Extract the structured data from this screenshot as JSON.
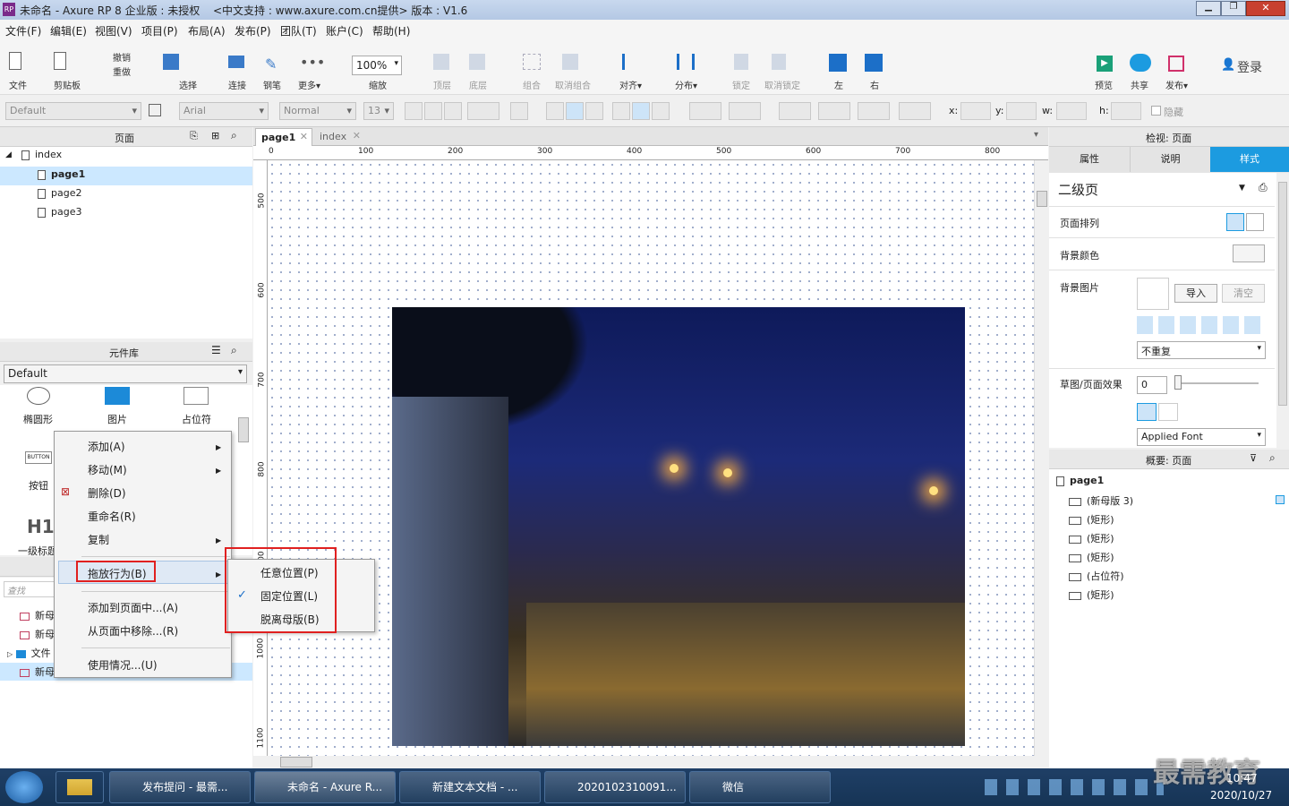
{
  "window": {
    "title": "未命名 - Axure RP 8 企业版 : 未授权",
    "subtitle": "<中文支持 : www.axure.com.cn提供> 版本 : V1.6"
  },
  "menu": [
    "文件(F)",
    "编辑(E)",
    "视图(V)",
    "项目(P)",
    "布局(A)",
    "发布(P)",
    "团队(T)",
    "账户(C)",
    "帮助(H)"
  ],
  "toolbar": {
    "file": "文件",
    "clipboard": "剪贴板",
    "undo": "撤销",
    "redo": "重做",
    "select": "选择",
    "connect": "连接",
    "pen": "钢笔",
    "more": "更多▾",
    "zoom_value": "100%",
    "zoom_label": "缩放",
    "top": "顶层",
    "bottom": "底层",
    "group": "组合",
    "ungroup": "取消组合",
    "align": "对齐▾",
    "distribute": "分布▾",
    "lock": "锁定",
    "unlock": "取消锁定",
    "left": "左",
    "right": "右",
    "preview": "预览",
    "share": "共享",
    "publish": "发布▾",
    "login": "登录"
  },
  "format": {
    "style": "Default",
    "font": "Arial",
    "weight": "Normal",
    "size": "13",
    "x": "x:",
    "y": "y:",
    "w": "w:",
    "h": "h:",
    "hide": "隐藏"
  },
  "pages_panel": {
    "title": "页面",
    "root": "index",
    "items": [
      "page1",
      "page2",
      "page3"
    ]
  },
  "library_panel": {
    "title": "元件库",
    "selected": "Default",
    "items": [
      "椭圆形",
      "图片",
      "占位符",
      "按钮",
      "一级标题"
    ],
    "button_text": "BUTTON",
    "h1_text": "H1"
  },
  "masters_panel": {
    "search_placeholder": "查找",
    "items": [
      "新母",
      "新母",
      "文件",
      "新母"
    ]
  },
  "tabs": [
    {
      "label": "page1"
    },
    {
      "label": "index"
    }
  ],
  "ruler_top": [
    "0",
    "100",
    "200",
    "300",
    "400",
    "500",
    "600",
    "700",
    "800"
  ],
  "ruler_left": [
    "500",
    "600",
    "700",
    "800",
    "900",
    "1000",
    "1100"
  ],
  "context_menu": {
    "items": [
      "添加(A)",
      "移动(M)",
      "删除(D)",
      "重命名(R)",
      "复制",
      "拖放行为(B)",
      "添加到页面中...(A)",
      "从页面中移除...(R)",
      "使用情况...(U)"
    ],
    "submenu": [
      "任意位置(P)",
      "固定位置(L)",
      "脱离母版(B)"
    ],
    "checked": "固定位置(L)"
  },
  "inspector": {
    "title": "检视: 页面",
    "tabs": [
      "属性",
      "说明",
      "样式"
    ],
    "active_tab": "样式",
    "page_name": "二级页",
    "page_align": "页面排列",
    "bg_color": "背景颜色",
    "bg_image": "背景图片",
    "import": "导入",
    "clear": "清空",
    "repeat": "不重复",
    "sketch": "草图/页面效果",
    "sketch_value": "0",
    "applied_font": "Applied Font"
  },
  "outline": {
    "title": "概要: 页面",
    "root": "page1",
    "items": [
      "(新母版 3)",
      "(矩形)",
      "(矩形)",
      "(矩形)",
      "(占位符)",
      "(矩形)"
    ]
  },
  "taskbar": {
    "tasks": [
      "发布提问 - 最需...",
      "未命名 - Axure R...",
      "新建文本文档 - ...",
      "2020102310091...",
      "微信"
    ],
    "time": "10:47",
    "date": "2020/10/27",
    "watermark": "最需教育"
  },
  "colors": {
    "accent": "#1c9be0",
    "highlight": "#cce8ff",
    "red_box": "#e02020"
  }
}
